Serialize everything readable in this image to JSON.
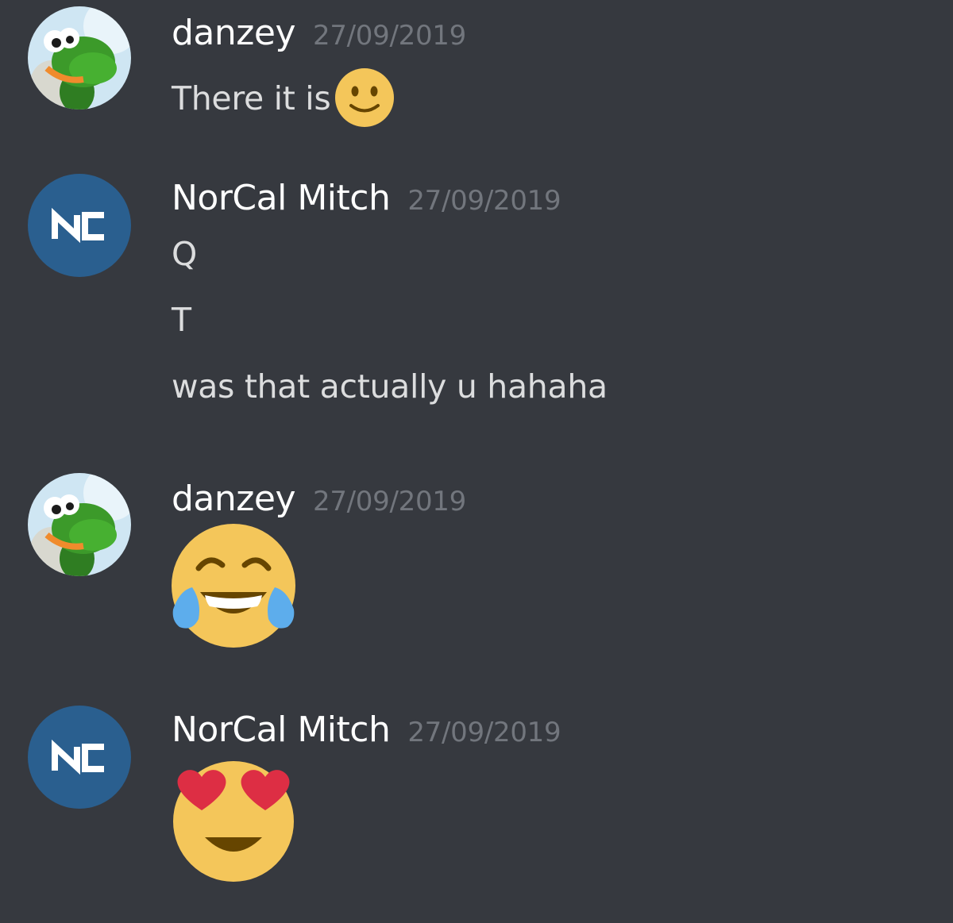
{
  "messages": [
    {
      "username": "danzey",
      "timestamp": "27/09/2019",
      "avatar_icon": "yoshi-avatar-icon",
      "lines": [
        "There it is"
      ],
      "inline_emoji": "slightly-smiling-face-icon"
    },
    {
      "username": "NorCal Mitch",
      "timestamp": "27/09/2019",
      "avatar_icon": "norcal-logo-icon",
      "lines": [
        "Q",
        "T",
        "was that actually u hahaha"
      ]
    },
    {
      "username": "danzey",
      "timestamp": "27/09/2019",
      "avatar_icon": "yoshi-avatar-icon",
      "jumbo_emoji": "tears-of-joy-icon"
    },
    {
      "username": "NorCal Mitch",
      "timestamp": "27/09/2019",
      "avatar_icon": "norcal-logo-icon",
      "jumbo_emoji": "heart-eyes-icon"
    }
  ],
  "colors": {
    "background": "#36393f",
    "username": "#ffffff",
    "timestamp": "#72767d",
    "message_text": "#dcddde",
    "norcal_avatar_bg": "#2a5f8f",
    "emoji_yellow": "#f4c65a"
  }
}
